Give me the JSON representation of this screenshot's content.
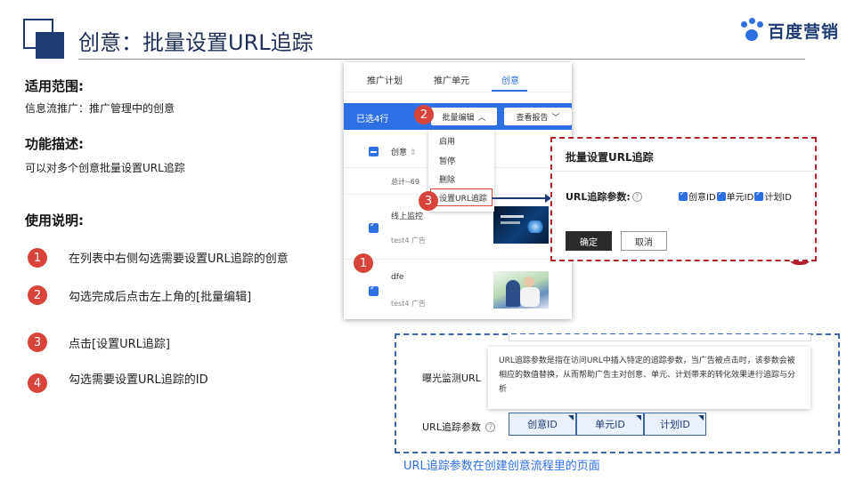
{
  "header": {
    "title": "创意：批量设置URL追踪",
    "brand": "百度营销"
  },
  "left": {
    "scope_heading": "适用范围:",
    "scope_text": "信息流推广：推广管理中的创意",
    "feature_heading": "功能描述:",
    "feature_text": "可以对多个创意批量设置URL追踪",
    "usage_heading": "使用说明:",
    "steps": [
      {
        "num": "1",
        "text": "在列表中右侧勾选需要设置URL追踪的创意"
      },
      {
        "num": "2",
        "text": "勾选完成后点击左上角的[批量编辑]"
      },
      {
        "num": "3",
        "text": "点击[设置URL追踪]"
      },
      {
        "num": "4",
        "text": "勾选需要设置URL追踪的ID"
      }
    ]
  },
  "panel1": {
    "tabs": [
      "推广计划",
      "推广单元",
      "创意"
    ],
    "selected_count": "已选4行",
    "bulk_edit": "批量编辑",
    "view_report": "查看报告",
    "col_creative": "创意",
    "total": "总计--69",
    "rows": [
      {
        "title": "线上监控",
        "sub": "test4 广告"
      },
      {
        "title": "dfe",
        "sub": "test4 广告"
      }
    ],
    "dropdown": [
      "启用",
      "暂停",
      "删除",
      "设置URL追踪"
    ],
    "badges": [
      "2",
      "3",
      "1"
    ]
  },
  "modal": {
    "title": "批量设置URL追踪",
    "label": "URL追踪参数:",
    "help": "?",
    "checkboxes": [
      "创意ID",
      "单元ID",
      "计划ID"
    ],
    "ok": "确定",
    "cancel": "取消"
  },
  "panel2": {
    "tooltip": "URL追踪参数是指在访问URL中插入特定的追踪参数，当广告被点击时，该参数会被相应的数值替换，从而帮助广告主对创意、单元、计划带来的转化效果进行追踪与分析",
    "label_exposure": "曝光监测URL",
    "label_params": "URL追踪参数",
    "help": "?",
    "buttons": [
      "创意ID",
      "单元ID",
      "计划ID"
    ]
  },
  "caption": "URL追踪参数在创建创意流程里的页面",
  "colors": {
    "accent_blue": "#2f6fe4",
    "navy": "#1f3b73",
    "step_red": "#d9443a",
    "modal_border": "#b31f2a"
  }
}
